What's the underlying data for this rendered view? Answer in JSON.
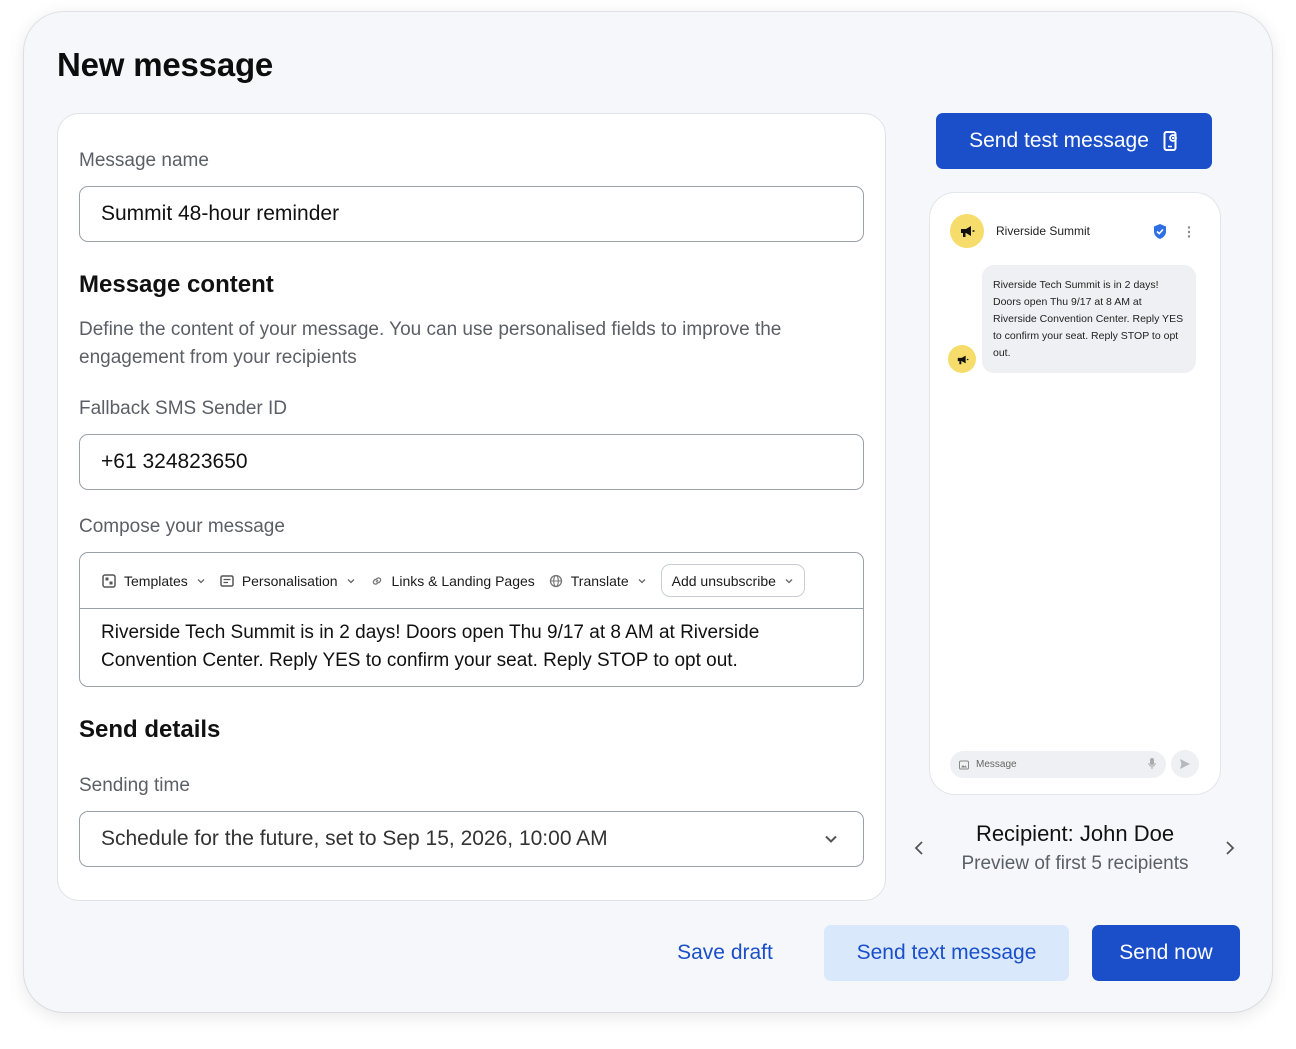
{
  "page": {
    "title": "New message"
  },
  "form": {
    "message_name": {
      "label": "Message name",
      "value": "Summit 48-hour reminder"
    },
    "content": {
      "heading": "Message content",
      "description": "Define the content of your message. You can use personalised fields to improve the engagement from your recipients"
    },
    "sender_id": {
      "label": "Fallback SMS Sender ID",
      "value": "+61 324823650"
    },
    "compose": {
      "label": "Compose your message",
      "toolbar": {
        "templates": "Templates",
        "personalisation": "Personalisation",
        "links": "Links & Landing Pages",
        "translate": "Translate",
        "unsubscribe": "Add unsubscribe"
      },
      "body": "Riverside Tech Summit is in 2 days! Doors open Thu 9/17 at 8 AM at Riverside Convention Center. Reply YES to confirm your seat. Reply STOP to opt out."
    },
    "send_details": {
      "heading": "Send details",
      "sending_time_label": "Sending time",
      "sending_time_value": "Schedule for the future, set to Sep 15, 2026, 10:00 AM"
    }
  },
  "preview": {
    "send_test_label": "Send test message",
    "sender_name": "Riverside Summit",
    "bubble_text": "Riverside Tech Summit is in 2 days! Doors open Thu 9/17 at 8 AM at Riverside Convention Center. Reply YES to confirm your seat. Reply STOP to opt out.",
    "input_placeholder": "Message",
    "recipient": "Recipient: John Doe",
    "recipient_sub": "Preview of first 5 recipients"
  },
  "actions": {
    "save_draft": "Save draft",
    "send_text": "Send text message",
    "send_now": "Send now"
  },
  "colors": {
    "accent": "#1a4fc9",
    "accent_light": "#d9e8fb",
    "avatar": "#f6dc6b",
    "verified": "#2f6fe4"
  },
  "icons": [
    "templates-icon",
    "personalisation-icon",
    "link-icon",
    "globe-icon",
    "chevron-down-icon",
    "phone-test-icon",
    "megaphone-icon",
    "verified-icon",
    "more-vertical-icon",
    "image-icon",
    "mic-icon",
    "send-icon",
    "chevron-left-icon",
    "chevron-right-icon"
  ]
}
